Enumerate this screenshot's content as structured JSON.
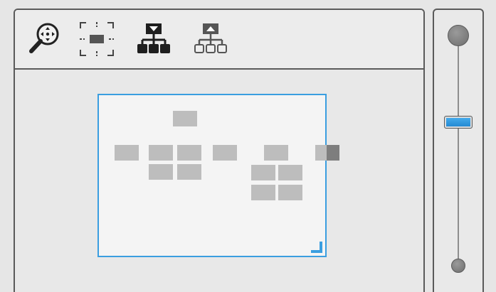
{
  "toolbar": {
    "tools": [
      {
        "icon": "zoom-fit-icon",
        "tooltip": ""
      },
      {
        "icon": "center-selection-icon",
        "tooltip": ""
      },
      {
        "icon": "expand-tree-icon",
        "tooltip": ""
      },
      {
        "icon": "collapse-tree-icon",
        "tooltip": ""
      }
    ]
  },
  "overview": {
    "viewport_color": "#3a9ee0"
  },
  "zoom": {
    "level_fraction": 0.62,
    "thumb_color": "#1e84cf"
  }
}
